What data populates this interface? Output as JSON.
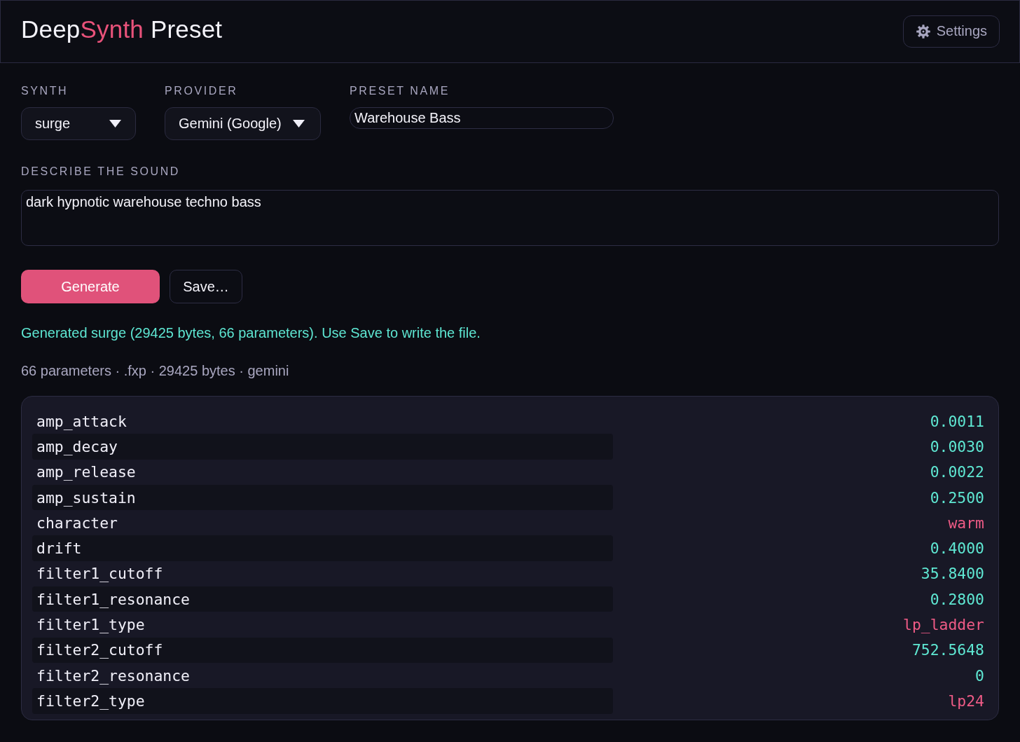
{
  "header": {
    "title": [
      {
        "text": "Deep",
        "accent": false
      },
      {
        "text": "Synth",
        "accent": true
      },
      {
        "text": " Preset",
        "accent": false
      }
    ],
    "settings_button": "Settings"
  },
  "form": {
    "synth": {
      "label": "SYNTH",
      "value": "surge"
    },
    "provider": {
      "label": "PROVIDER",
      "value": "Gemini (Google)"
    },
    "preset_name": {
      "label": "PRESET NAME",
      "value": "Warehouse Bass"
    },
    "description": {
      "label": "DESCRIBE THE SOUND",
      "value": "dark hypnotic warehouse techno bass"
    }
  },
  "actions": [
    {
      "label": "Generate",
      "kind": "primary"
    },
    {
      "label": "Save…",
      "kind": "secondary"
    }
  ],
  "status_message": "Generated surge (29425 bytes, 66 parameters). Use Save to write the file.",
  "summary": "66 parameters · .fxp · 29425 bytes · gemini",
  "parameters": [
    {
      "name": "amp_attack",
      "value": "0.0011",
      "kind": "number"
    },
    {
      "name": "amp_decay",
      "value": "0.0030",
      "kind": "number"
    },
    {
      "name": "amp_release",
      "value": "0.0022",
      "kind": "number"
    },
    {
      "name": "amp_sustain",
      "value": "0.2500",
      "kind": "number"
    },
    {
      "name": "character",
      "value": "warm",
      "kind": "text"
    },
    {
      "name": "drift",
      "value": "0.4000",
      "kind": "number"
    },
    {
      "name": "filter1_cutoff",
      "value": "35.8400",
      "kind": "number"
    },
    {
      "name": "filter1_resonance",
      "value": "0.2800",
      "kind": "number"
    },
    {
      "name": "filter1_type",
      "value": "lp_ladder",
      "kind": "text"
    },
    {
      "name": "filter2_cutoff",
      "value": "752.5648",
      "kind": "number"
    },
    {
      "name": "filter2_resonance",
      "value": "0",
      "kind": "number"
    },
    {
      "name": "filter2_type",
      "value": "lp24",
      "kind": "text"
    }
  ]
}
